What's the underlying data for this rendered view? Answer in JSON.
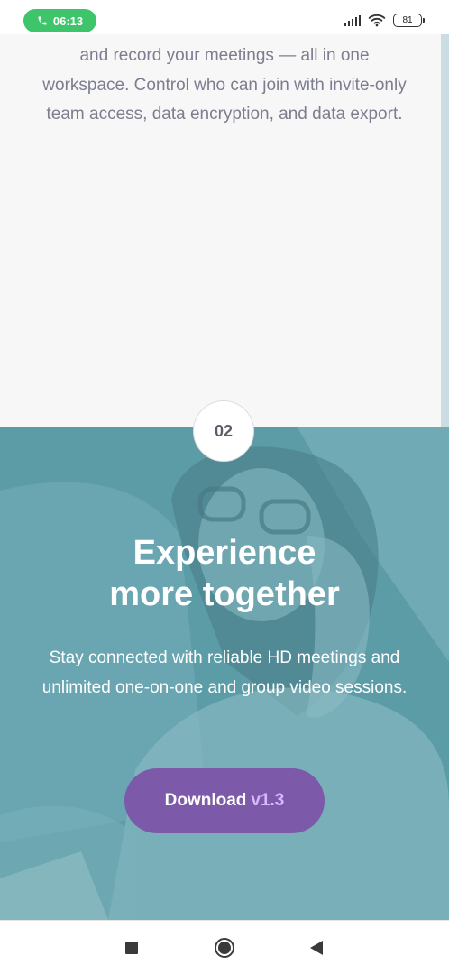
{
  "status_bar": {
    "time": "06:13",
    "battery": "81"
  },
  "intro": {
    "text": "and record your meetings — all in one workspace. Control who can join with invite-only team access, data encryption, and data export."
  },
  "step": {
    "number": "02"
  },
  "hero": {
    "title_line1": "Experience",
    "title_line2": "more together",
    "description": "Stay connected with reliable HD meetings and unlimited one-on-one and group video sessions.",
    "button_label": "Download",
    "button_version": "v1.3"
  },
  "colors": {
    "accent_purple": "#7d5aa9",
    "version_lilac": "#d7b9ff",
    "teal_overlay": "#5f9fab",
    "call_green": "#3ec46a"
  },
  "icons": {
    "call": "phone-icon",
    "signal": "signal-icon",
    "wifi": "wifi-icon",
    "battery": "battery-icon",
    "recents": "square-icon",
    "home": "circle-icon",
    "back": "triangle-back-icon"
  }
}
